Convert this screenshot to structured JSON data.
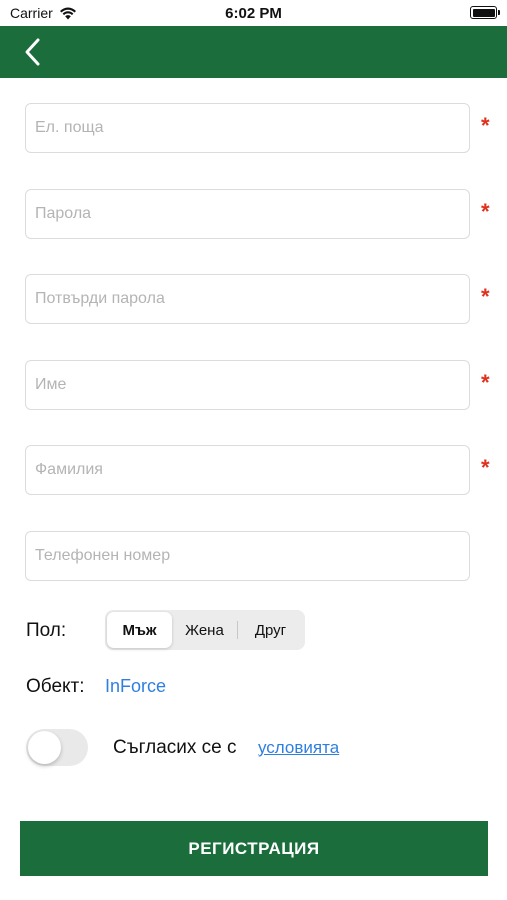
{
  "status_bar": {
    "carrier": "Carrier",
    "time": "6:02 PM"
  },
  "colors": {
    "brand_green": "#1b6e3c",
    "link_blue": "#2f7fe0",
    "required_red": "#e0301e"
  },
  "form": {
    "fields": [
      {
        "placeholder": "Ел. поща",
        "value": "",
        "required_mark": "*"
      },
      {
        "placeholder": "Парола",
        "value": "",
        "required_mark": "*"
      },
      {
        "placeholder": "Потвърди парола",
        "value": "",
        "required_mark": "*"
      },
      {
        "placeholder": "Име",
        "value": "",
        "required_mark": "*"
      },
      {
        "placeholder": "Фамилия",
        "value": "",
        "required_mark": "*"
      },
      {
        "placeholder": "Телефонен номер",
        "value": ""
      }
    ],
    "gender": {
      "label": "Пол:",
      "options": [
        "Мъж",
        "Жена",
        "Друг"
      ],
      "selected": "Мъж"
    },
    "object": {
      "label": "Обект:",
      "value": "InForce"
    },
    "terms": {
      "agreed": false,
      "text": "Съгласих се с",
      "link_text": "условията"
    },
    "submit_label": "РЕГИСТРАЦИЯ"
  }
}
